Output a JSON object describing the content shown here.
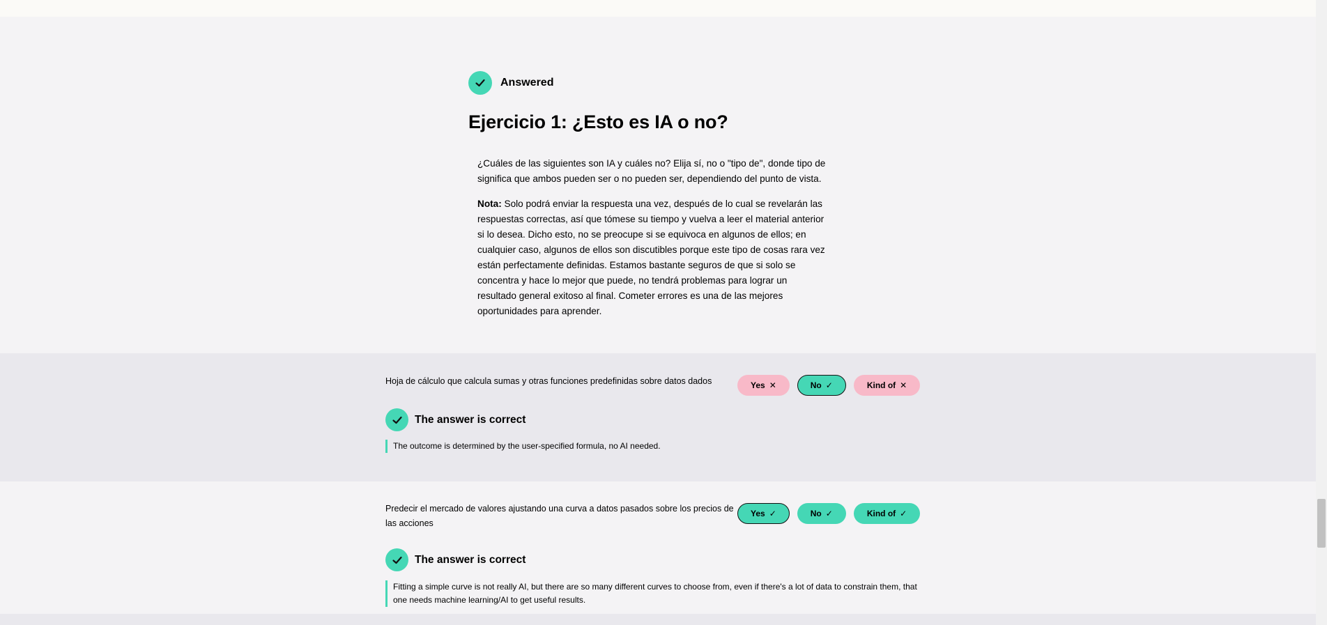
{
  "status": {
    "label": "Answered",
    "icon": "check-icon"
  },
  "exercise": {
    "title": "Ejercicio 1: ¿Esto es IA o no?",
    "intro": "¿Cuáles de las siguientes son IA y cuáles no? Elija sí, no o \"tipo de\", donde tipo de significa que ambos pueden ser o no pueden ser, dependiendo del punto de vista.",
    "note_label": "Nota:",
    "note_text": " Solo podrá enviar la respuesta una vez, después de lo cual se revelarán las respuestas correctas, así que tómese su tiempo y vuelva a leer el material anterior si lo desea. Dicho esto, no se preocupe si se equivoca en algunos de ellos; en cualquier caso, algunos de ellos son discutibles porque este tipo de cosas rara vez están perfectamente definidas. Estamos bastante seguros de que si solo se concentra y hace lo mejor que puede, no tendrá problemas para lograr un resultado general exitoso al final. Cometer errores es una de las mejores oportunidades para aprender."
  },
  "questions": [
    {
      "text": "Hoja de cálculo que calcula sumas y otras funciones predefinidas sobre datos dados",
      "choices": [
        {
          "label": "Yes",
          "mark": "✕",
          "color": "#f8b9c8",
          "selected": false
        },
        {
          "label": "No",
          "mark": "✓",
          "color": "#45d7b5",
          "selected": true
        },
        {
          "label": "Kind of",
          "mark": "✕",
          "color": "#f8b9c8",
          "selected": false
        }
      ],
      "result": "The answer is correct",
      "explanation": "The outcome is determined by the user-specified formula, no AI needed."
    },
    {
      "text": "Predecir el mercado de valores ajustando una curva a datos pasados sobre los precios de las acciones",
      "choices": [
        {
          "label": "Yes",
          "mark": "✓",
          "color": "#45d7b5",
          "selected": true
        },
        {
          "label": "No",
          "mark": "✓",
          "color": "#45d7b5",
          "selected": false
        },
        {
          "label": "Kind of",
          "mark": "✓",
          "color": "#45d7b5",
          "selected": false
        }
      ],
      "result": "The answer is correct",
      "explanation": "Fitting a simple curve is not really AI, but there are so many different curves to choose from, even if there's a lot of data to constrain them, that one needs machine learning/AI to get useful results."
    }
  ],
  "colors": {
    "accent": "#45d7b5",
    "wrong": "#f8b9c8",
    "shade": "#e9e8ed",
    "background": "#f4f3f5"
  }
}
